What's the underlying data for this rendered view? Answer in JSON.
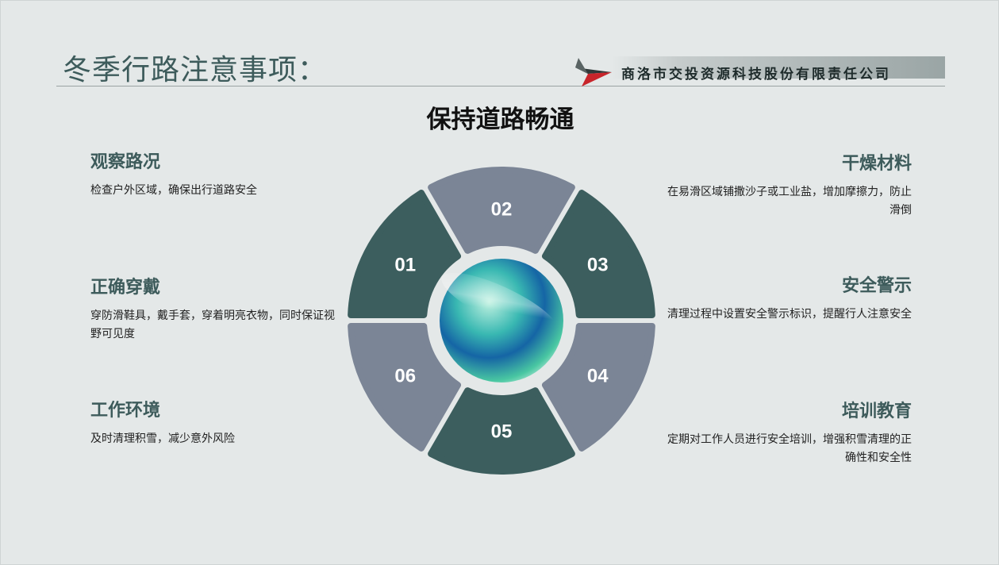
{
  "page_title": "冬季行路注意事项：",
  "company": {
    "name": "商洛市交投资源科技股份有限责任公司"
  },
  "diagram_title": "保持道路畅通",
  "colors": {
    "dark_segment": "#3c5e5e",
    "light_segment": "#7b8596",
    "background": "#e4e8e8"
  },
  "segments": [
    {
      "label": "01",
      "tone": "dark"
    },
    {
      "label": "02",
      "tone": "light"
    },
    {
      "label": "03",
      "tone": "dark"
    },
    {
      "label": "04",
      "tone": "light"
    },
    {
      "label": "05",
      "tone": "dark"
    },
    {
      "label": "06",
      "tone": "light"
    }
  ],
  "items_left": [
    {
      "heading": "观察路况",
      "text": "检查户外区域，确保出行道路安全"
    },
    {
      "heading": "正确穿戴",
      "text": "穿防滑鞋具，戴手套，穿着明亮衣物，同时保证视野可见度"
    },
    {
      "heading": "工作环境",
      "text": "及时清理积雪，减少意外风险"
    }
  ],
  "items_right": [
    {
      "heading": "干燥材料",
      "text": "在易滑区域铺撒沙子或工业盐，增加摩擦力，防止滑倒"
    },
    {
      "heading": "安全警示",
      "text": "清理过程中设置安全警示标识，提醒行人注意安全"
    },
    {
      "heading": "培训教育",
      "text": "定期对工作人员进行安全培训，增强积雪清理的正确性和安全性"
    }
  ]
}
